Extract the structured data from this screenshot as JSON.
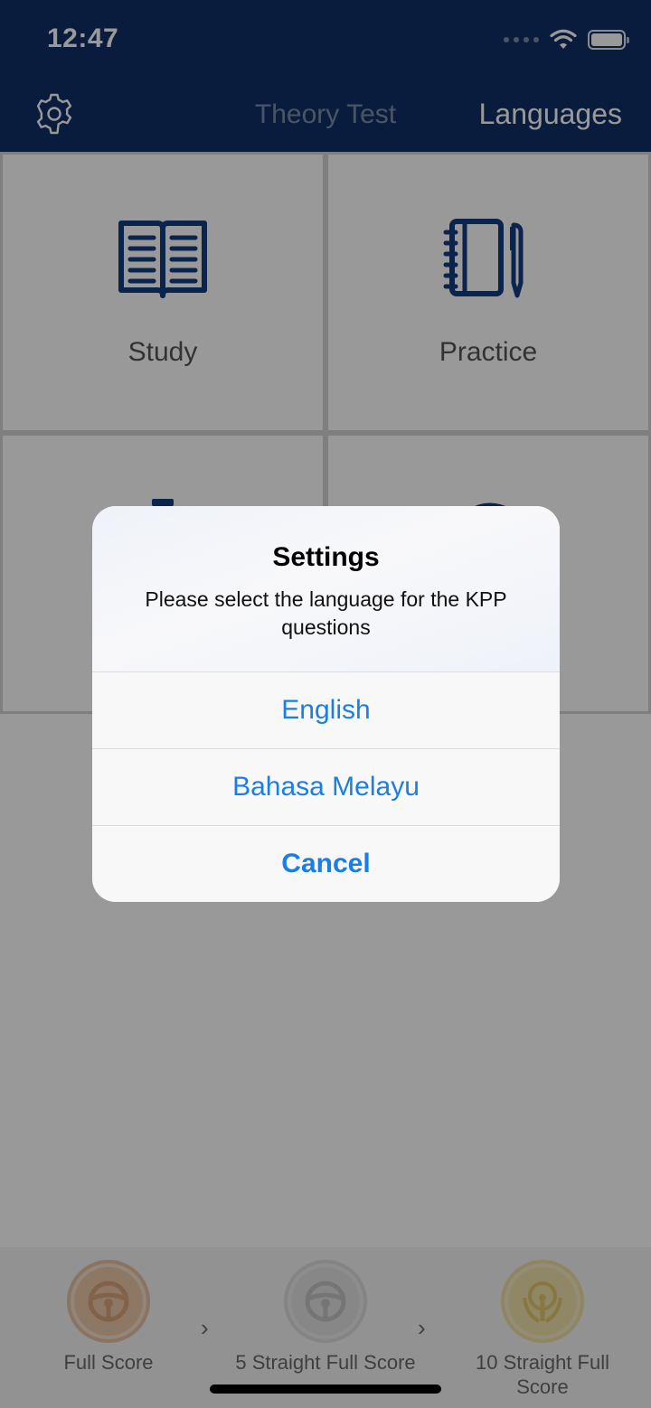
{
  "status_bar": {
    "time": "12:47"
  },
  "nav": {
    "title": "Theory Test",
    "right_button": "Languages",
    "left_icon": "gear-icon"
  },
  "tiles": [
    {
      "label": "Study",
      "icon": "open-book-icon"
    },
    {
      "label": "Practice",
      "icon": "notebook-pen-icon"
    },
    {
      "label": "",
      "icon": "stopwatch-icon"
    },
    {
      "label": "",
      "icon": "history-icon"
    }
  ],
  "achievements": [
    {
      "label": "Full Score",
      "icon": "steering-wheel-icon",
      "color": "#d9a57a"
    },
    {
      "label": "5 Straight Full Score",
      "icon": "steering-wheel-icon",
      "color": "#c8c8c8"
    },
    {
      "label": "10 Straight Full Score",
      "icon": "steering-wheel-laurel-icon",
      "color": "#e8cf7c"
    }
  ],
  "dialog": {
    "title": "Settings",
    "message": "Please select the language for the KPP questions",
    "options": [
      "English",
      "Bahasa Melayu"
    ],
    "cancel": "Cancel"
  },
  "colors": {
    "header": "#123066",
    "accent": "#1a7ee6",
    "icon_blue": "#123d82"
  }
}
